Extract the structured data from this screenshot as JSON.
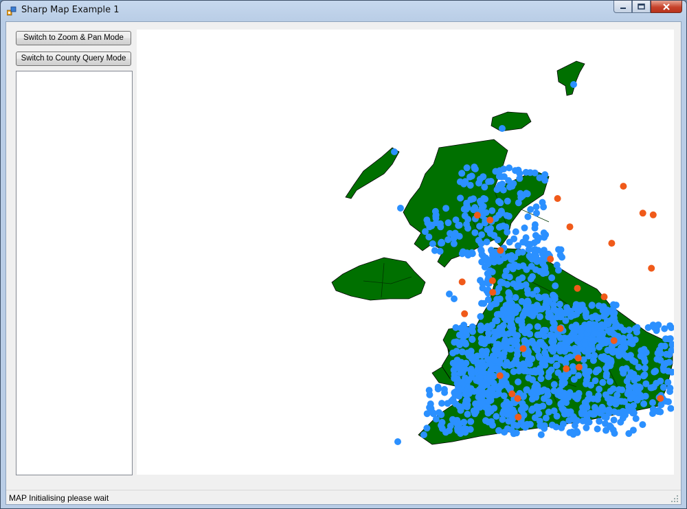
{
  "window": {
    "title": "Sharp Map Example 1"
  },
  "icons": {
    "app": "map-app-icon",
    "minimize": "minimize-icon",
    "maximize": "maximize-icon",
    "close": "close-icon",
    "grip": "resize-grip-icon"
  },
  "buttons": {
    "zoom_pan": "Switch to Zoom & Pan Mode",
    "county_query": "Switch to County Query Mode"
  },
  "map": {
    "land_color": "#007000",
    "point_color": "#2b90ff",
    "highlight_color": "#f05a1a",
    "background_color": "#ffffff"
  },
  "status": {
    "text": "MAP Initialising please wait"
  }
}
